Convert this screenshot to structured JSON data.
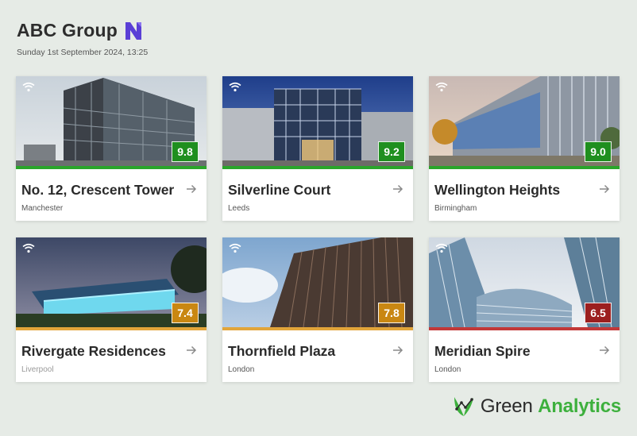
{
  "header": {
    "title": "ABC Group",
    "datetime": "Sunday 1st September 2024, 13:25",
    "logo_icon": "n-logo-icon"
  },
  "colors": {
    "good": "#2aa52a",
    "warning": "#e2a53a",
    "poor": "#c23838",
    "badge_good": "#1f8f1f",
    "badge_warning": "#c98712",
    "badge_poor": "#9c1f1f",
    "brand_green": "#3db03d",
    "background": "#e6ebe6"
  },
  "cards": [
    {
      "name": "No. 12, Crescent Tower",
      "city": "Manchester",
      "score": "9.8",
      "status": "good",
      "icons": [
        "wifi-icon",
        "arrow-right-icon"
      ]
    },
    {
      "name": "Silverline Court",
      "city": "Leeds",
      "score": "9.2",
      "status": "good",
      "icons": [
        "wifi-icon",
        "arrow-right-icon"
      ]
    },
    {
      "name": "Wellington Heights",
      "city": "Birmingham",
      "score": "9.0",
      "status": "good",
      "icons": [
        "wifi-icon",
        "arrow-right-icon"
      ]
    },
    {
      "name": "Rivergate Residences",
      "city": "Liverpool",
      "score": "7.4",
      "status": "warning",
      "icons": [
        "wifi-icon",
        "arrow-right-icon"
      ]
    },
    {
      "name": "Thornfield Plaza",
      "city": "London",
      "score": "7.8",
      "status": "warning",
      "icons": [
        "wifi-icon",
        "arrow-right-icon"
      ]
    },
    {
      "name": "Meridian Spire",
      "city": "London",
      "score": "6.5",
      "status": "poor",
      "icons": [
        "wifi-icon",
        "arrow-right-icon"
      ]
    }
  ],
  "brand": {
    "word1": "Green",
    "word2": "Analytics",
    "icon": "leaf-analytics-icon"
  }
}
